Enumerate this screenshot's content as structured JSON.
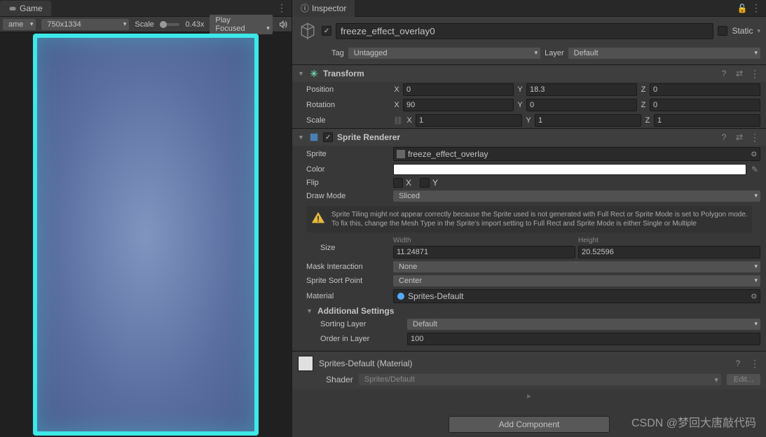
{
  "game": {
    "tab_label": "Game",
    "name_dropdown": "ame",
    "resolution": "750x1334",
    "scale_label": "Scale",
    "scale_value": "0.43x",
    "play_mode": "Play Focused"
  },
  "inspector": {
    "tab_label": "Inspector",
    "name": "freeze_effect_overlay0",
    "static_label": "Static",
    "tag_label": "Tag",
    "tag_value": "Untagged",
    "layer_label": "Layer",
    "layer_value": "Default"
  },
  "transform": {
    "title": "Transform",
    "position_label": "Position",
    "position": {
      "x": "0",
      "y": "18.3",
      "z": "0"
    },
    "rotation_label": "Rotation",
    "rotation": {
      "x": "90",
      "y": "0",
      "z": "0"
    },
    "scale_label": "Scale",
    "scale": {
      "x": "1",
      "y": "1",
      "z": "1"
    }
  },
  "sprite_renderer": {
    "title": "Sprite Renderer",
    "sprite_label": "Sprite",
    "sprite_value": "freeze_effect_overlay",
    "color_label": "Color",
    "color_value": "#ffffff",
    "flip_label": "Flip",
    "flip_x": "X",
    "flip_y": "Y",
    "draw_mode_label": "Draw Mode",
    "draw_mode_value": "Sliced",
    "warning": "Sprite Tiling might not appear correctly because the Sprite used is not generated with Full Rect or Sprite Mode is set to Polygon mode. To fix this, change the Mesh Type in the Sprite's import setting to Full Rect and Sprite Mode is either Single or Multiple",
    "size_label": "Size",
    "width_label": "Width",
    "width_value": "11.24871",
    "height_label": "Height",
    "height_value": "20.52596",
    "mask_label": "Mask Interaction",
    "mask_value": "None",
    "sort_point_label": "Sprite Sort Point",
    "sort_point_value": "Center",
    "material_label": "Material",
    "material_value": "Sprites-Default",
    "additional_title": "Additional Settings",
    "sorting_layer_label": "Sorting Layer",
    "sorting_layer_value": "Default",
    "order_label": "Order in Layer",
    "order_value": "100"
  },
  "material": {
    "title": "Sprites-Default (Material)",
    "shader_label": "Shader",
    "shader_value": "Sprites/Default",
    "edit_label": "Edit..."
  },
  "add_component": "Add Component",
  "watermark": "CSDN @梦回大唐敲代码"
}
